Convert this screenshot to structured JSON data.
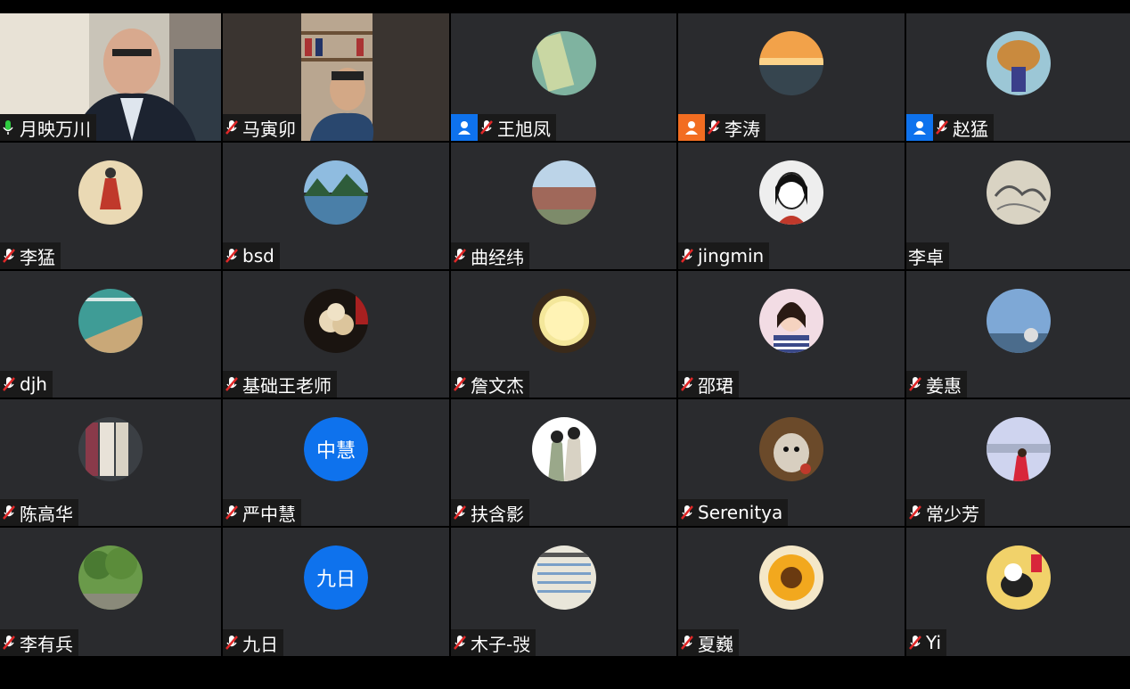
{
  "colors": {
    "tile_bg": "#2a2b2e",
    "label_bg": "#1a1a1a",
    "muted_red": "#e02828",
    "unmuted_green": "#2ecc40",
    "host_blue": "#0e72ed",
    "cohost_orange": "#f26d21"
  },
  "participants": [
    {
      "name": "月映万川",
      "video": "video-1",
      "mic": "on",
      "badge": null
    },
    {
      "name": "马寅卯",
      "video": "video-2",
      "mic": "muted",
      "badge": null
    },
    {
      "name": "王旭凤",
      "avatar": "img",
      "mic": "muted",
      "badge": "blue"
    },
    {
      "name": "李涛",
      "avatar": "img",
      "mic": "muted",
      "badge": "orange"
    },
    {
      "name": "赵猛",
      "avatar": "img",
      "mic": "muted",
      "badge": "blue"
    },
    {
      "name": "李猛",
      "avatar": "img",
      "mic": "muted",
      "badge": null
    },
    {
      "name": "bsd",
      "avatar": "img",
      "mic": "muted",
      "badge": null
    },
    {
      "name": "曲经纬",
      "avatar": "img",
      "mic": "muted",
      "badge": null
    },
    {
      "name": "jingmin",
      "avatar": "img",
      "mic": "muted",
      "badge": null
    },
    {
      "name": "李卓",
      "avatar": "img",
      "mic": "none",
      "badge": null
    },
    {
      "name": "djh",
      "avatar": "img",
      "mic": "muted",
      "badge": null
    },
    {
      "name": "基础王老师",
      "avatar": "img",
      "mic": "muted",
      "badge": null
    },
    {
      "name": "詹文杰",
      "avatar": "img",
      "mic": "muted",
      "badge": null
    },
    {
      "name": "邵珺",
      "avatar": "img",
      "mic": "muted",
      "badge": null
    },
    {
      "name": "姜惠",
      "avatar": "img",
      "mic": "muted",
      "badge": null
    },
    {
      "name": "陈高华",
      "avatar": "img",
      "mic": "muted",
      "badge": null
    },
    {
      "name": "严中慧",
      "avatar_text": "中慧",
      "mic": "muted",
      "badge": null
    },
    {
      "name": "扶含影",
      "avatar": "img",
      "mic": "muted",
      "badge": null
    },
    {
      "name": "Serenitya",
      "avatar": "img",
      "mic": "muted",
      "badge": null
    },
    {
      "name": "常少芳",
      "avatar": "img",
      "mic": "muted",
      "badge": null
    },
    {
      "name": "李有兵",
      "avatar": "img",
      "mic": "muted",
      "badge": null
    },
    {
      "name": "九日",
      "avatar_text": "九日",
      "mic": "muted",
      "badge": null
    },
    {
      "name": "木子-弢",
      "avatar": "img",
      "mic": "muted",
      "badge": null
    },
    {
      "name": "夏巍",
      "avatar": "img",
      "mic": "muted",
      "badge": null
    },
    {
      "name": "Yi",
      "avatar": "img",
      "mic": "muted",
      "badge": null
    }
  ]
}
